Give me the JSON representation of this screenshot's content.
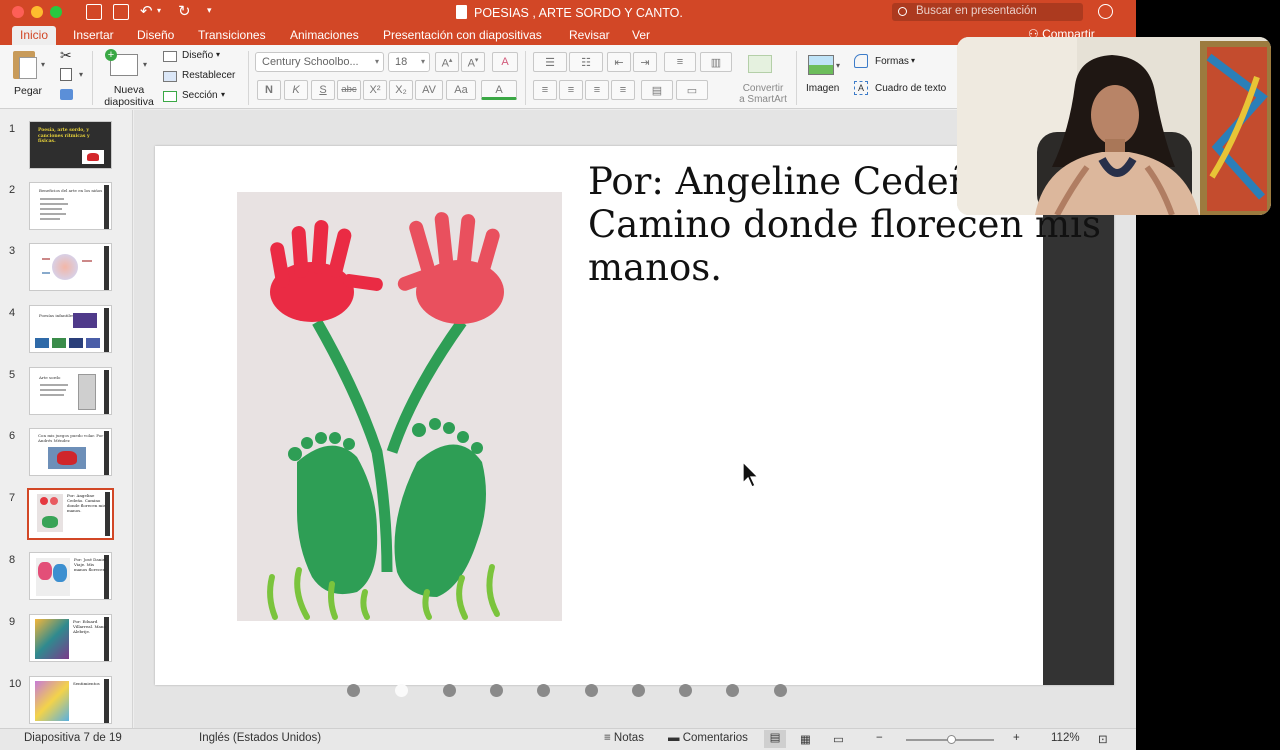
{
  "window": {
    "title": "POESIAS , ARTE SORDO Y CANTO.",
    "search_placeholder": "Buscar en presentación",
    "titlebar_color": "#d24726"
  },
  "ribbon_tabs": [
    {
      "label": "Inicio",
      "active": true
    },
    {
      "label": "Insertar"
    },
    {
      "label": "Diseño"
    },
    {
      "label": "Transiciones"
    },
    {
      "label": "Animaciones"
    },
    {
      "label": "Presentación con diapositivas"
    },
    {
      "label": "Revisar"
    },
    {
      "label": "Ver"
    }
  ],
  "share_label": "Compartir",
  "ribbon": {
    "paste": "Pegar",
    "new_slide_1": "Nueva",
    "new_slide_2": "diapositiva",
    "layout": "Diseño",
    "reset": "Restablecer",
    "section": "Sección",
    "font_name": "Century Schoolbo...",
    "font_size": "18",
    "bold": "N",
    "italic": "K",
    "underline": "S",
    "strike": "abc",
    "superscript": "X²",
    "subscript": "X₂",
    "convert_smartart_1": "Convertir",
    "convert_smartart_2": "a SmartArt",
    "image": "Imagen",
    "shapes": "Formas",
    "textbox": "Cuadro de texto"
  },
  "thumbnails": [
    {
      "num": "1",
      "title": "Poesía, arte sordo, y canciones rítmicas y físicas."
    },
    {
      "num": "2",
      "title": "Beneficios del arte en los niños"
    },
    {
      "num": "3",
      "title": ""
    },
    {
      "num": "4",
      "title": "Poesías infantiles"
    },
    {
      "num": "5",
      "title": "Arte sordo"
    },
    {
      "num": "6",
      "title": "Con mis juegos puedo volar. Por Andrés Méndez"
    },
    {
      "num": "7",
      "title": "Por: Angeline Cedeño. Camino donde florecen mis manos.",
      "selected": true
    },
    {
      "num": "8",
      "title": "Por: José Daniel Viaje. Mis manos florecen."
    },
    {
      "num": "9",
      "title": "Por: Eduard Villarreal. Mano Alebrije."
    },
    {
      "num": "10",
      "title": "Sentimientos"
    }
  ],
  "slide": {
    "line1": "Por: Angeline Cedeño",
    "line2": "Camino donde florecen mis",
    "line3": "manos."
  },
  "status": {
    "slide_counter": "Diapositiva 7 de 19",
    "language": "Inglés (Estados Unidos)",
    "notes": "Notas",
    "comments": "Comentarios",
    "zoom": "112%"
  },
  "carousel": {
    "count": 10,
    "active_index": 1
  }
}
